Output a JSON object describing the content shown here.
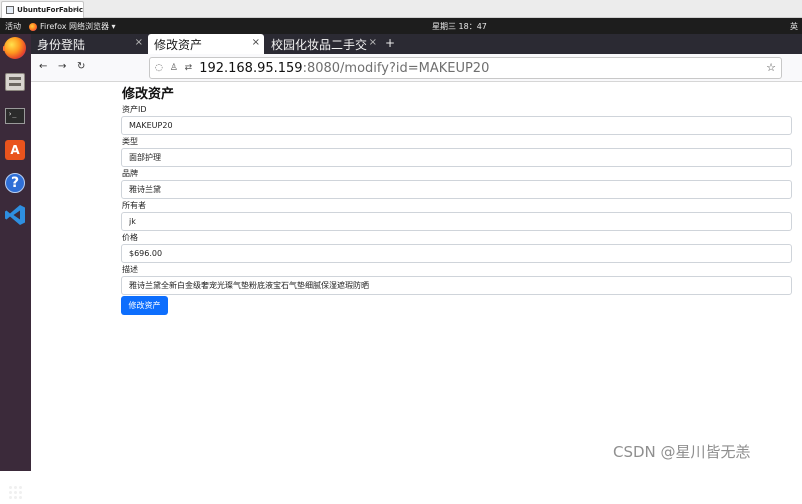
{
  "vm": {
    "tab_title": "UbuntuForFabric",
    "tab_close": "×"
  },
  "topbar": {
    "activities": "活动",
    "app_menu": "Firefox 网络浏览器 ▾",
    "clock": "星期三 18：47",
    "lang": "英"
  },
  "dock": {
    "terminal_glyph": "›_",
    "software_glyph": "A",
    "help_glyph": "?"
  },
  "browser": {
    "tabs": [
      {
        "label": "身份登陆",
        "close": "×"
      },
      {
        "label": "修改资产",
        "close": "×"
      },
      {
        "label": "校园化妆品二手交",
        "close": "×"
      }
    ],
    "new_tab": "+",
    "back": "←",
    "forward": "→",
    "reload": "↻",
    "url_icons": "◌ ♙ ⇄",
    "url_host": "192.168.95.159",
    "url_path": ":8080/modify?id=MAKEUP20",
    "bookmark_star": "☆"
  },
  "form": {
    "title": "修改资产",
    "fields": [
      {
        "label": "资产ID",
        "value": "MAKEUP20"
      },
      {
        "label": "类型",
        "value": "面部护理"
      },
      {
        "label": "品牌",
        "value": "雅诗兰黛"
      },
      {
        "label": "所有者",
        "value": "jk"
      },
      {
        "label": "价格",
        "value": "$696.00"
      },
      {
        "label": "描述",
        "value": "雅诗兰黛全新白金级奢宠光璨气垫粉底液宝石气垫细腻保湿遮瑕防晒"
      }
    ],
    "submit_label": "修改资产"
  },
  "watermark": "CSDN @星川皆无恙"
}
